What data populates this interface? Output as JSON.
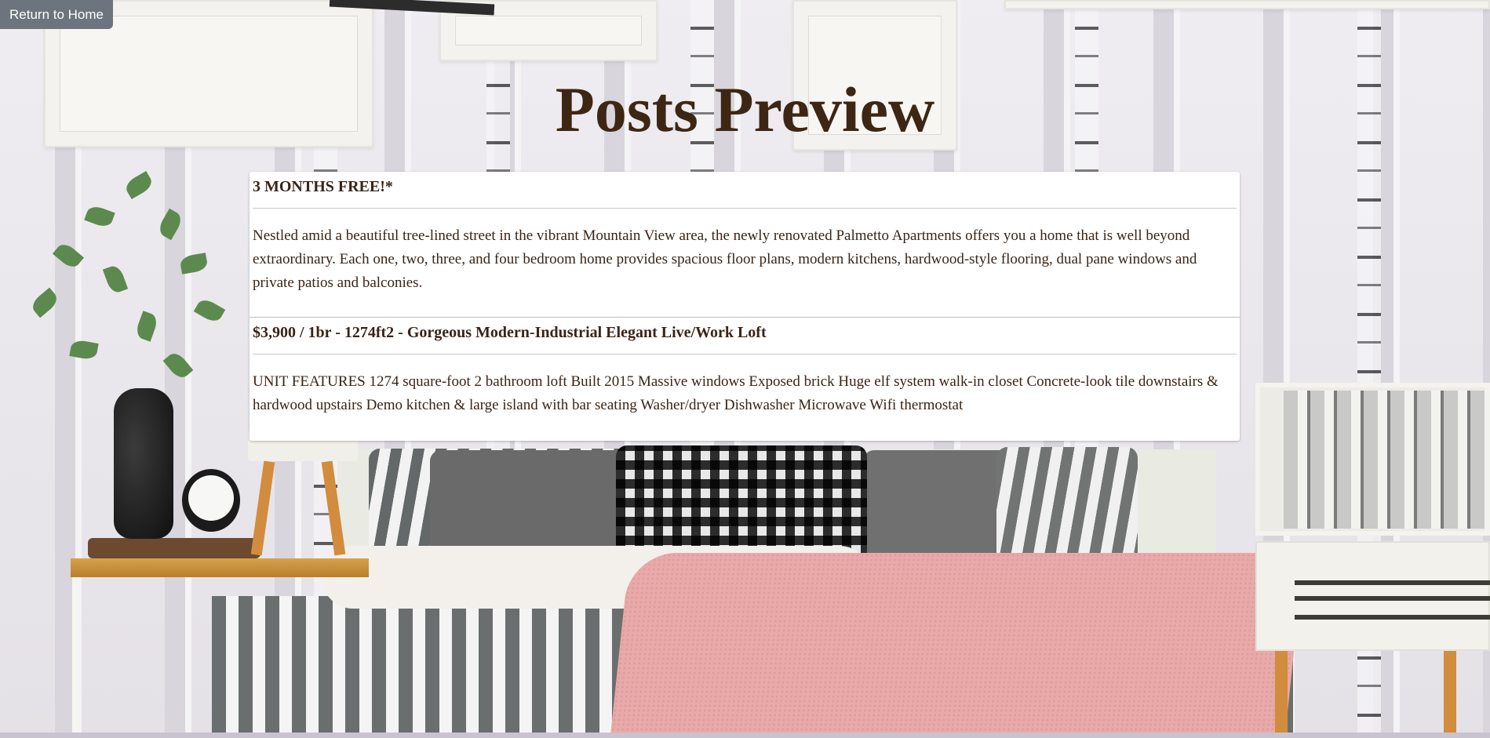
{
  "nav": {
    "home_label": "Return to Home"
  },
  "page": {
    "title": "Posts Preview"
  },
  "posts": [
    {
      "title": "3 MONTHS FREE!*",
      "body": "Nestled amid a beautiful tree-lined street in the vibrant Mountain View area, the newly renovated Palmetto Apartments offers you a home that is well beyond extraordinary. Each one, two, three, and four bedroom home provides spacious floor plans, modern kitchens, hardwood-style flooring, dual pane windows and private patios and balconies."
    },
    {
      "title": "$3,900 / 1br - 1274ft2 - Gorgeous Modern-Industrial Elegant Live/Work Loft",
      "body": "UNIT FEATURES 1274 square-foot 2 bathroom loft Built 2015 Massive windows Exposed brick Huge elf system walk-in closet Concrete-look tile downstairs & hardwood upstairs Demo kitchen & large island with bar seating Washer/dryer Dishwasher Microwave Wifi thermostat"
    }
  ],
  "colors": {
    "title": "#3d2614",
    "button": "#6c757d",
    "text": "#3a2418"
  }
}
